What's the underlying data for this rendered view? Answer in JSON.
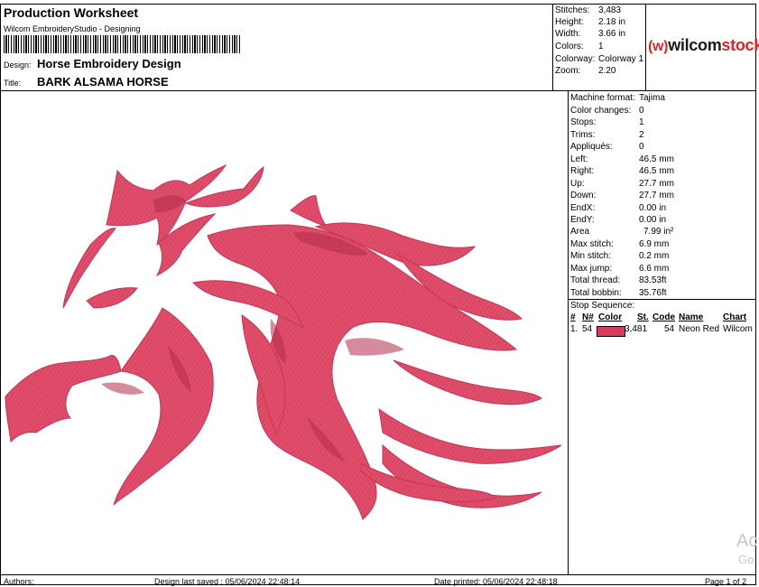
{
  "header": {
    "title": "Production Worksheet",
    "software": "Wilcom EmbroideryStudio - Designing",
    "design_label": "Design:",
    "design_value": "Horse Embroidery Design",
    "title_label": "Title:",
    "title_value": "BARK ALSAMA HORSE"
  },
  "summary": [
    {
      "label": "Stitches:",
      "value": "3,483"
    },
    {
      "label": "Height:",
      "value": "2.18 in"
    },
    {
      "label": "Width:",
      "value": "3.66 in"
    },
    {
      "label": "Colors:",
      "value": "1"
    },
    {
      "label": "Colorway:",
      "value": "Colorway 1"
    },
    {
      "label": "Zoom:",
      "value": "2.20"
    }
  ],
  "logo": {
    "prefix": "wilcom",
    "suffix": "stock",
    "accent": "#d9262b"
  },
  "machine": [
    {
      "label": "Machine format:",
      "value": "Tajima"
    },
    {
      "label": "Color changes:",
      "value": "0"
    },
    {
      "label": "Stops:",
      "value": "1"
    },
    {
      "label": "Trims:",
      "value": "2"
    },
    {
      "label": "Appliqués:",
      "value": "0"
    },
    {
      "label": "Left:",
      "value": "46.5 mm"
    },
    {
      "label": "Right:",
      "value": "46.5 mm"
    },
    {
      "label": "Up:",
      "value": "27.7 mm"
    },
    {
      "label": "Down:",
      "value": "27.7 mm"
    },
    {
      "label": "EndX:",
      "value": "0.00 in"
    },
    {
      "label": "EndY:",
      "value": "0.00 in"
    },
    {
      "label": "Area",
      "value": "7.99 in²"
    },
    {
      "label": "Max stitch:",
      "value": "6.9 mm"
    },
    {
      "label": "Min stitch:",
      "value": "0.2 mm"
    },
    {
      "label": "Max jump:",
      "value": "6.6 mm"
    },
    {
      "label": "Total thread:",
      "value": "83.53ft"
    },
    {
      "label": "Total bobbin:",
      "value": "35.76ft"
    }
  ],
  "stop_sequence": {
    "title": "Stop Sequence:",
    "headers": {
      "num": "#",
      "n": "N#",
      "color": "Color",
      "st": "St.",
      "code": "Code",
      "name": "Name",
      "chart": "Chart"
    },
    "row": {
      "num": "1.",
      "n": "54",
      "color_hex": "#d63d5c",
      "st": "3,481",
      "code": "54",
      "name": "Neon Red",
      "chart": "Wilcom"
    }
  },
  "footer": {
    "authors": "Authors:",
    "saved": "Design last saved : 05/06/2024 22:48:14",
    "printed": "Date printed: 05/06/2024 22:48:18",
    "page": "Page 1 of 2"
  },
  "watermark": {
    "line1": "Ac",
    "line2": "Go"
  },
  "artwork": {
    "fill": "#df4d6b",
    "shadow": "#b22e4c"
  }
}
